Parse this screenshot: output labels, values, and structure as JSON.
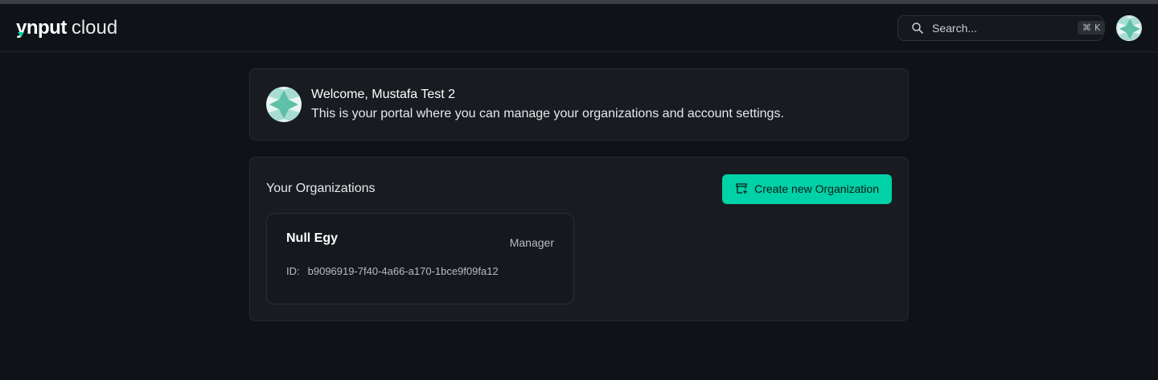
{
  "header": {
    "logo_brand": "ynput",
    "logo_suffix": "cloud",
    "search_placeholder": "Search...",
    "shortcut_symbol": "⌘",
    "shortcut_key": "K"
  },
  "welcome": {
    "title": "Welcome, Mustafa Test 2",
    "subtitle": "This is your portal where you can manage your organizations and account settings."
  },
  "organizations": {
    "title": "Your Organizations",
    "create_button_label": "Create new Organization",
    "items": [
      {
        "name": "Null Egy",
        "role": "Manager",
        "id_label": "ID:",
        "id_value": "b9096919-7f40-4a66-a170-1bce9f09fa12"
      }
    ]
  },
  "colors": {
    "accent": "#00d1a7",
    "background": "#0f1216",
    "card": "#181c21"
  },
  "icons": {
    "search": "search-icon",
    "create": "building-plus-icon",
    "avatar": "geometric-avatar"
  }
}
